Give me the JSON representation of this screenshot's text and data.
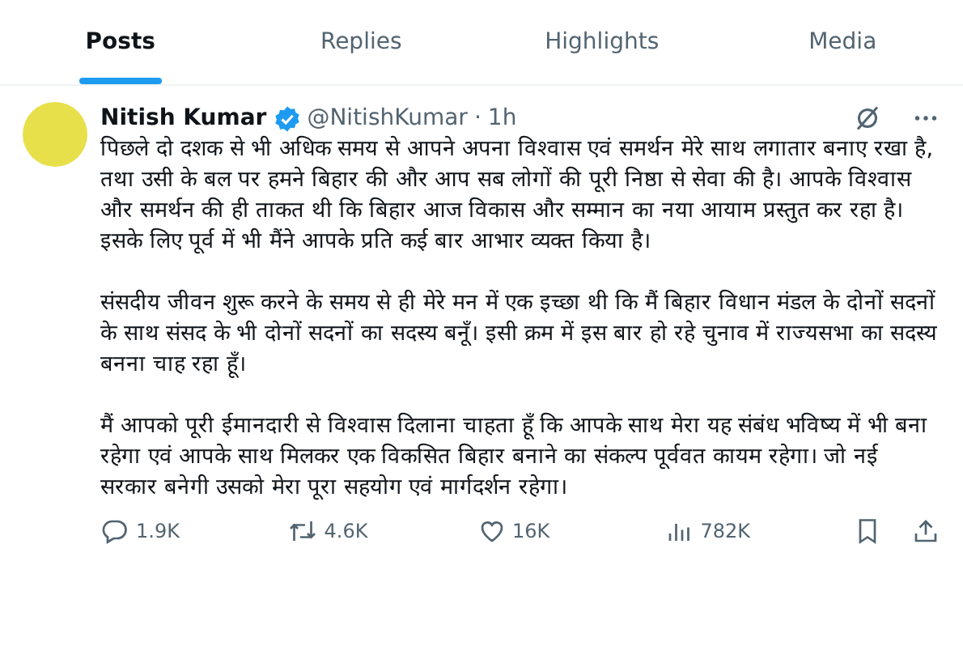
{
  "tabs": [
    {
      "label": "Posts",
      "selected": true
    },
    {
      "label": "Replies",
      "selected": false
    },
    {
      "label": "Highlights",
      "selected": false
    },
    {
      "label": "Media",
      "selected": false
    }
  ],
  "post": {
    "author": "Nitish Kumar",
    "verified": true,
    "handle": "@NitishKumar",
    "separator": "·",
    "time": "1h",
    "paragraphs": [
      "पिछले दो दशक से भी अधिक समय से आपने अपना विश्वास एवं समर्थन मेरे साथ लगातार बनाए रखा है, तथा उसी के बल पर हमने बिहार की और आप सब लोगों की पूरी निष्ठा से सेवा की है। आपके विश्वास और समर्थन की ही ताकत थी कि बिहार आज विकास और सम्मान का नया आयाम प्रस्तुत कर रहा है। इसके लिए पूर्व में भी मैंने आपके प्रति कई बार आभार व्यक्त किया है।",
      "संसदीय जीवन शुरू करने के समय से ही मेरे मन में एक इच्छा थी कि मैं बिहार विधान मंडल के दोनों सदनों के साथ संसद के भी दोनों सदनों का सदस्य बनूँ। इसी क्रम में इस बार हो रहे चुनाव में राज्यसभा का सदस्य बनना चाह रहा हूँ।",
      "मैं आपको पूरी ईमानदारी से विश्वास दिलाना चाहता हूँ कि आपके साथ मेरा यह संबंध भविष्य में भी बना रहेगा एवं आपके साथ मिलकर एक विकसित बिहार बनाने का संकल्प पूर्ववत कायम रहेगा। जो नई सरकार बनेगी उसको मेरा पूरा सहयोग एवं मार्गदर्शन रहेगा।"
    ],
    "actions": [
      {
        "kind": "reply",
        "count": "1.9K"
      },
      {
        "kind": "repost",
        "count": "4.6K"
      },
      {
        "kind": "like",
        "count": "16K"
      },
      {
        "kind": "views",
        "count": "782K"
      }
    ]
  }
}
